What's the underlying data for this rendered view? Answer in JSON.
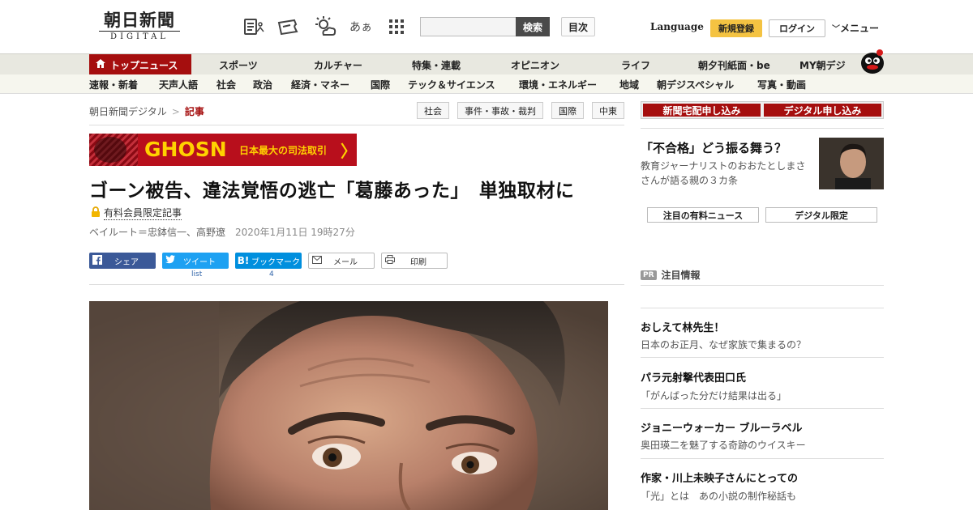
{
  "header": {
    "logo_kanji": "朝日新聞",
    "logo_sub": "DIGITAL",
    "search_label": "検索",
    "mokuji_label": "目次",
    "language_label": "Language",
    "signup_label": "新規登録",
    "login_label": "ログイン",
    "menu_label": "メニュー",
    "aa_label": "あぁ"
  },
  "mainnav": [
    {
      "label": "トップニュース"
    },
    {
      "label": "スポーツ"
    },
    {
      "label": "カルチャー"
    },
    {
      "label": "特集・連載"
    },
    {
      "label": "オピニオン"
    },
    {
      "label": "ライフ"
    },
    {
      "label": "朝夕刊紙面・be"
    },
    {
      "label": "MY朝デジ"
    }
  ],
  "subnav": [
    {
      "label": "速報・新着"
    },
    {
      "label": "天声人語"
    },
    {
      "label": "社会"
    },
    {
      "label": "政治"
    },
    {
      "label": "経済・マネー"
    },
    {
      "label": "国際"
    },
    {
      "label": "テック＆サイエンス"
    },
    {
      "label": "環境・エネルギー"
    },
    {
      "label": "地域"
    },
    {
      "label": "朝デジスペシャル"
    },
    {
      "label": "写真・動画"
    }
  ],
  "breadcrumb": {
    "root": "朝日新聞デジタル",
    "sep": ">",
    "current": "記事"
  },
  "tags": [
    "社会",
    "事件・事故・裁判",
    "国際",
    "中東"
  ],
  "banner": {
    "title": "GHOSN",
    "subtitle": "日本最大の司法取引",
    "arrow": "〉"
  },
  "article": {
    "headline": "ゴーン被告、違法覚悟の逃亡「葛藤あった」　単独取材に",
    "paywall_label": "有料会員限定記事",
    "byline": "ベイルート＝忠鉢信一、高野遼",
    "timestamp": "2020年1月11日 19時27分"
  },
  "share": {
    "facebook": "シェア",
    "twitter": "ツイート",
    "twitter_count": "list",
    "hatena": "ブックマーク",
    "hatena_count": "4",
    "mail": "メール",
    "print": "印刷"
  },
  "sidebar": {
    "subscribe_paper": "新聞宅配申し込み",
    "subscribe_digital": "デジタル申し込み",
    "feature_title": "「不合格」どう振る舞う？",
    "feature_desc": "教育ジャーナリストのおおたとしまささんが語る親の３カ条",
    "tab_news": "注目の有料ニュース",
    "tab_digital": "デジタル限定",
    "pr_badge": "PR",
    "pr_heading": "注目情報",
    "pr_items": [
      {
        "title": "おしえて林先生！",
        "desc": "日本のお正月、なぜ家族で集まるの？"
      },
      {
        "title": "パラ元射撃代表田口氏",
        "desc": "「がんばった分だけ結果は出る」"
      },
      {
        "title": "ジョニーウォーカー ブルーラベル",
        "desc": "奥田瑛二を魅了する奇跡のウイスキー"
      },
      {
        "title": "作家・川上未映子さんにとっての",
        "desc": "「光」とは　あの小説の制作秘話も"
      }
    ]
  },
  "colors": {
    "brand_red": "#a50e0e",
    "signup_yellow": "#f4c342",
    "banner_yellow": "#ffd200"
  }
}
